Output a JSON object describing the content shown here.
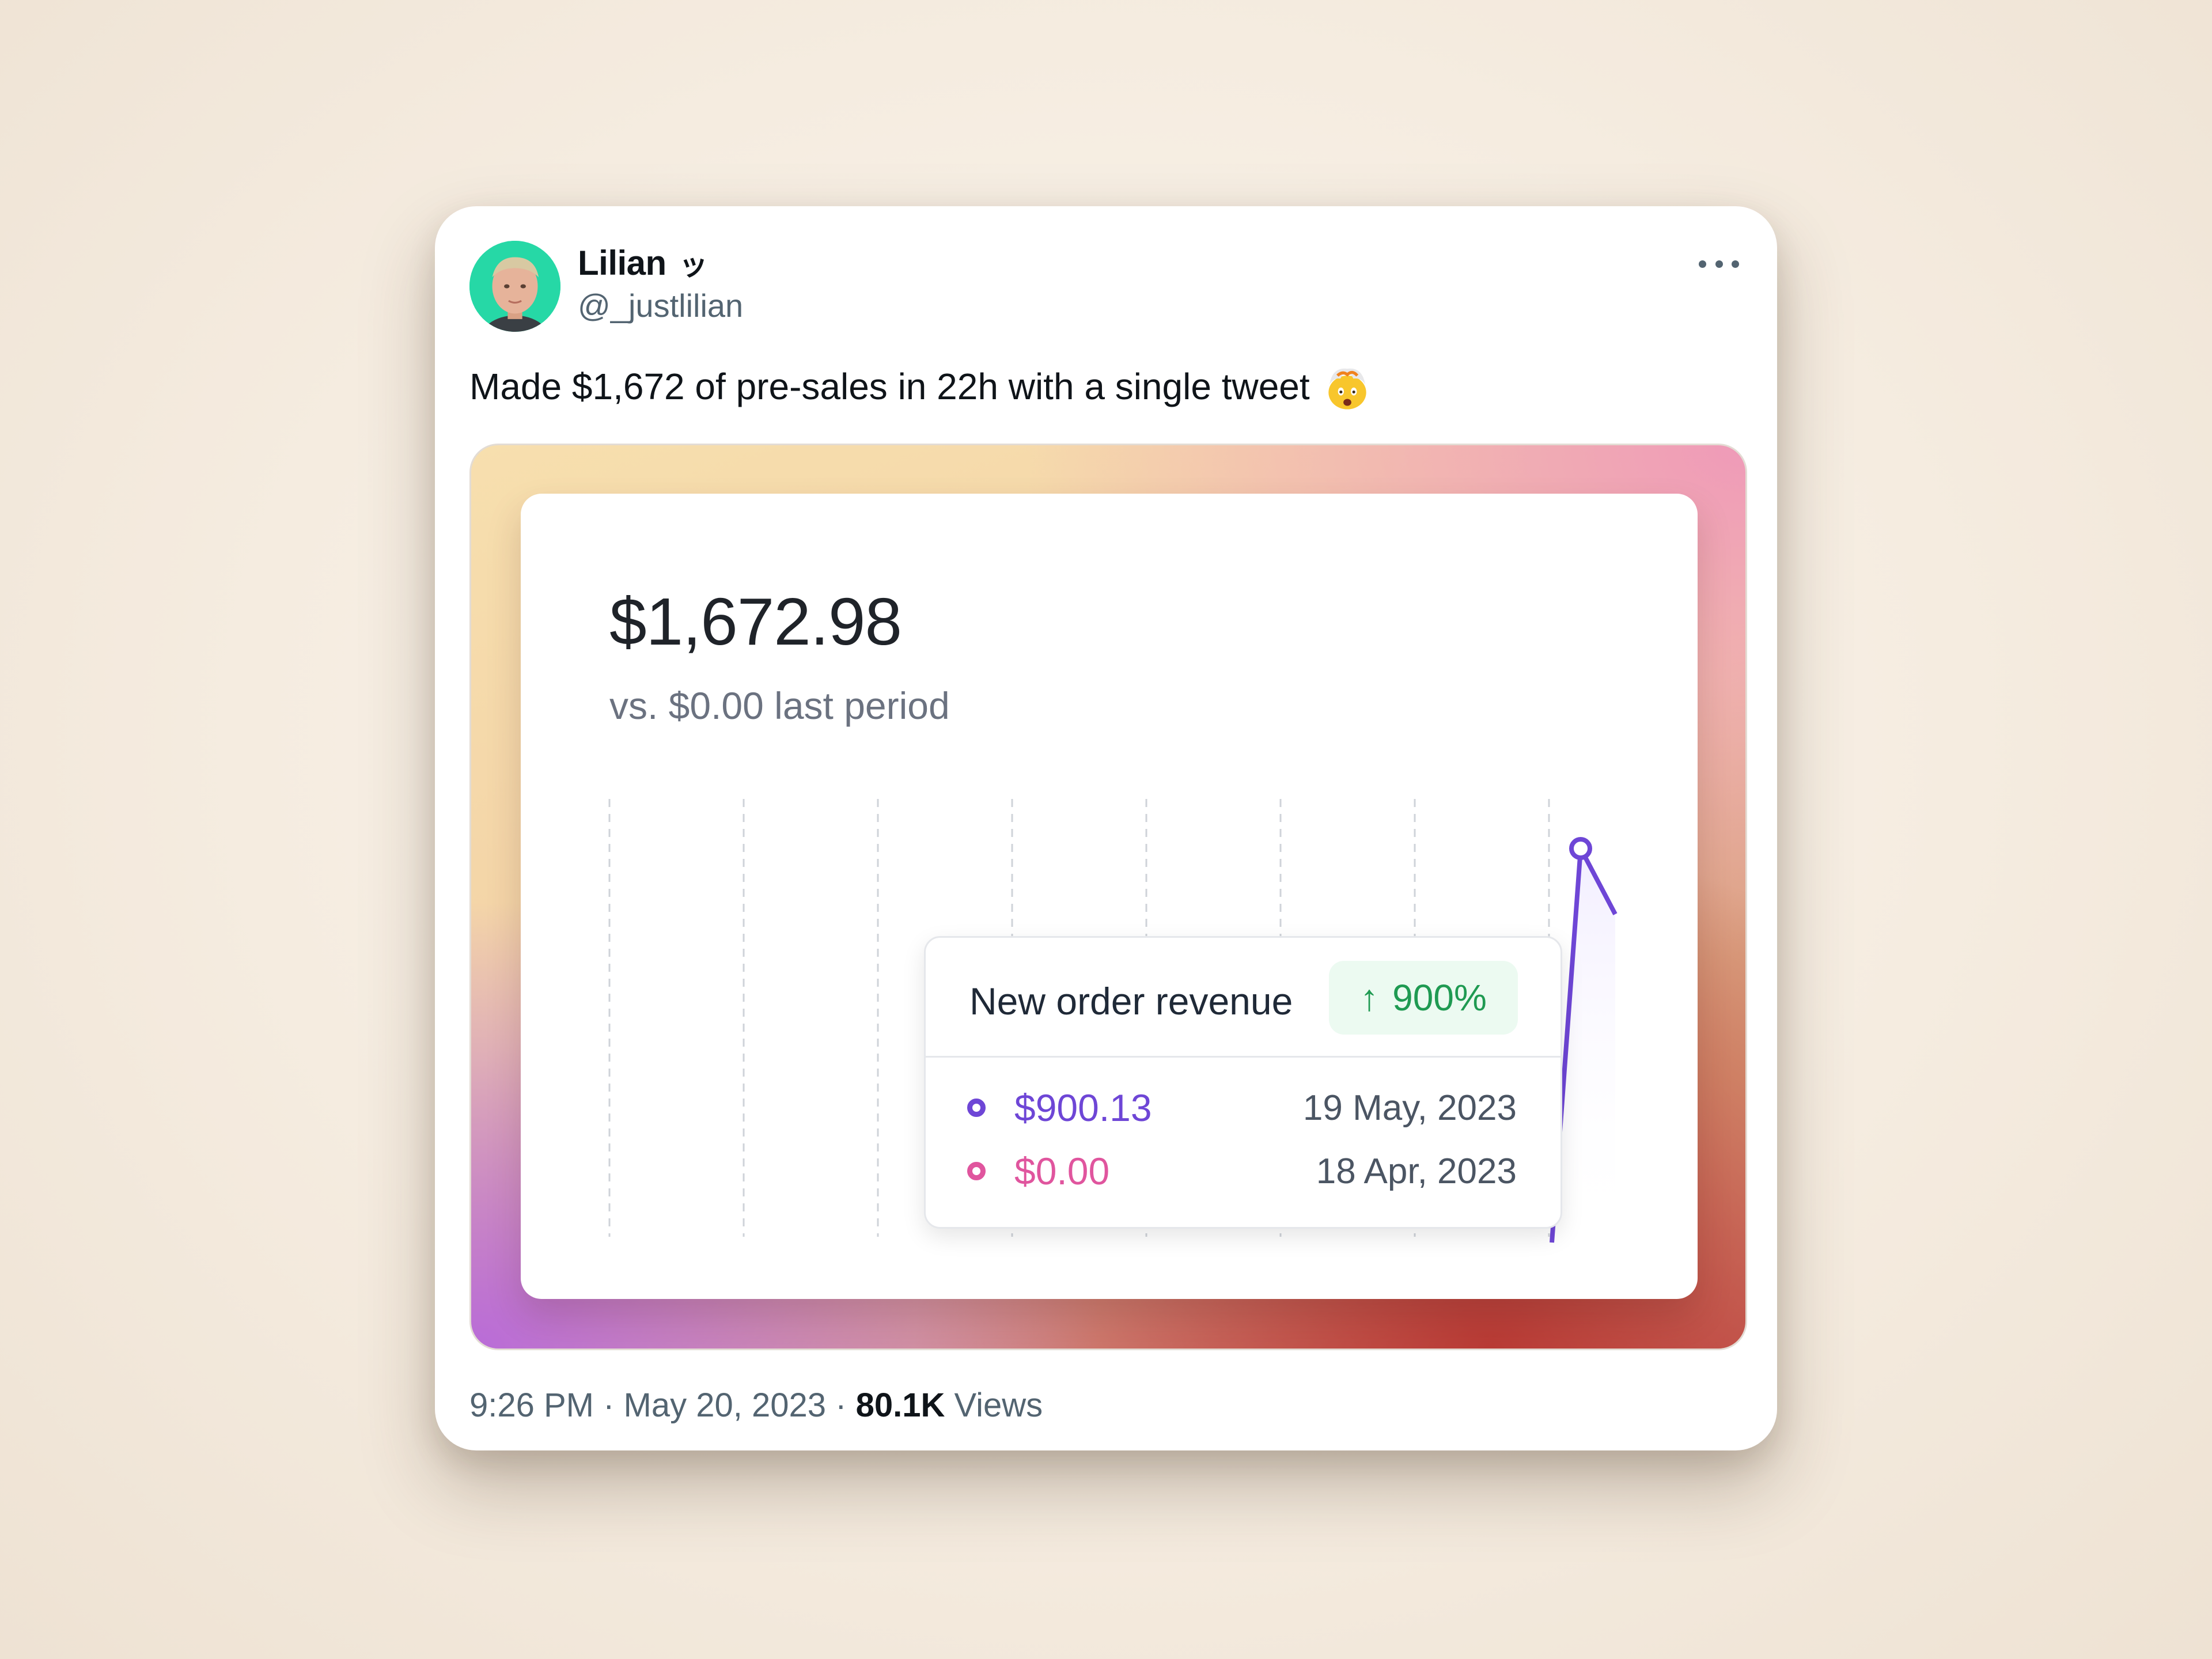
{
  "tweet": {
    "display_name": "Lilian",
    "name_emoji": "ッ",
    "handle": "@_justlilian",
    "text": "Made $1,672 of pre-sales in 22h with a single tweet",
    "text_emoji": "exploding-head-emoji",
    "time": "9:26 PM",
    "date": "May 20, 2023",
    "separator": " · ",
    "views_count": "80.1K",
    "views_label": "Views",
    "more_icon": "ellipsis-icon"
  },
  "media": {
    "amount": "$1,672.98",
    "comparison": "vs. $0.00 last period",
    "tooltip": {
      "title": "New order revenue",
      "badge_arrow": "↑",
      "badge_value": "900%",
      "rows": [
        {
          "value": "$900.13",
          "date": "19 May, 2023",
          "color": "#6e46d6"
        },
        {
          "value": "$0.00",
          "date": "18 Apr, 2023",
          "color": "#e0559e"
        }
      ]
    },
    "colors": {
      "line": "#6e46d6",
      "badge_text": "#1f9a52",
      "avatar_bg": "#26d8a6"
    }
  }
}
